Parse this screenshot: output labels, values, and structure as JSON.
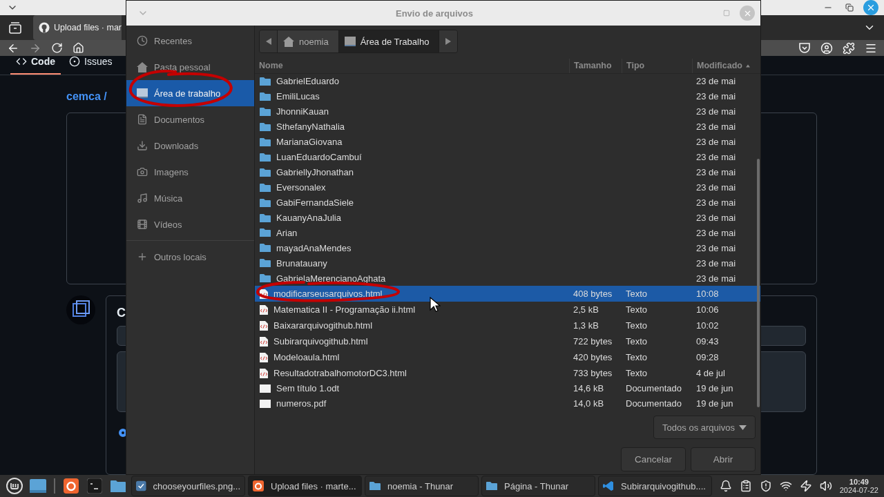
{
  "browser": {
    "tab": {
      "title": "Upload files · mar"
    },
    "repo_tabs": [
      {
        "label": "Code",
        "kind": "code",
        "selected": true
      },
      {
        "label": "Issues",
        "kind": "issues",
        "selected": false
      }
    ],
    "breadcrumb": "cemca /",
    "comment_heading": "C",
    "commit_option": {
      "selected": true
    }
  },
  "dialog": {
    "title": "Envio de arquivos",
    "places": [
      {
        "label": "Recentes",
        "kind": "clock",
        "selected": false
      },
      {
        "label": "Pasta pessoal",
        "kind": "home",
        "selected": false
      },
      {
        "label": "Área de trabalho",
        "kind": "desktop",
        "selected": true
      },
      {
        "label": "Documentos",
        "kind": "document",
        "selected": false
      },
      {
        "label": "Downloads",
        "kind": "download",
        "selected": false
      },
      {
        "label": "Imagens",
        "kind": "camera",
        "selected": false
      },
      {
        "label": "Música",
        "kind": "music",
        "selected": false
      },
      {
        "label": "Vídeos",
        "kind": "film",
        "selected": false
      }
    ],
    "other_places": "Outros locais",
    "path": [
      {
        "label": "noemia",
        "kind": "home",
        "selected": false
      },
      {
        "label": "Área de Trabalho",
        "kind": "desktop",
        "selected": true
      }
    ],
    "columns": [
      {
        "label": "Nome",
        "sorted": false
      },
      {
        "label": "Tamanho",
        "sorted": false
      },
      {
        "label": "Tipo",
        "sorted": false
      },
      {
        "label": "Modificado",
        "sorted": true
      }
    ],
    "files": [
      {
        "name": "GabrielEduardo",
        "kind": "folder",
        "modified": "23 de mai",
        "selected": false
      },
      {
        "name": "EmiliLucas",
        "kind": "folder",
        "modified": "23 de mai",
        "selected": false
      },
      {
        "name": "JhonniKauan",
        "kind": "folder",
        "modified": "23 de mai",
        "selected": false
      },
      {
        "name": "SthefanyNathalia",
        "kind": "folder",
        "modified": "23 de mai",
        "selected": false
      },
      {
        "name": "MarianaGiovana",
        "kind": "folder",
        "modified": "23 de mai",
        "selected": false
      },
      {
        "name": "LuanEduardoCambuí",
        "kind": "folder",
        "modified": "23 de mai",
        "selected": false
      },
      {
        "name": "GabriellyJhonathan",
        "kind": "folder",
        "modified": "23 de mai",
        "selected": false
      },
      {
        "name": "Eversonalex",
        "kind": "folder",
        "modified": "23 de mai",
        "selected": false
      },
      {
        "name": "GabiFernandaSiele",
        "kind": "folder",
        "modified": "23 de mai",
        "selected": false
      },
      {
        "name": "KauanyAnaJulia",
        "kind": "folder",
        "modified": "23 de mai",
        "selected": false
      },
      {
        "name": "Arian",
        "kind": "folder",
        "modified": "23 de mai",
        "selected": false
      },
      {
        "name": "mayadAnaMendes",
        "kind": "folder",
        "modified": "23 de mai",
        "selected": false
      },
      {
        "name": "Brunatauany",
        "kind": "folder",
        "modified": "23 de mai",
        "selected": false
      },
      {
        "name": "GabrielaMerencianoAghata",
        "kind": "folder",
        "modified": "23 de mai",
        "selected": false
      },
      {
        "name": "modificarseusarquivos.html",
        "kind": "html",
        "size": "408 bytes",
        "type": "Texto",
        "modified": "10:08",
        "selected": true
      },
      {
        "name": "Matematica II - Programação ii.html",
        "kind": "html",
        "size": "2,5 kB",
        "type": "Texto",
        "modified": "10:06",
        "selected": false
      },
      {
        "name": "Baixararquivogithub.html",
        "kind": "html",
        "size": "1,3 kB",
        "type": "Texto",
        "modified": "10:02",
        "selected": false
      },
      {
        "name": "Subirarquivogithub.html",
        "kind": "html",
        "size": "722 bytes",
        "type": "Texto",
        "modified": "09:43",
        "selected": false
      },
      {
        "name": "Modeloaula.html",
        "kind": "html",
        "size": "420 bytes",
        "type": "Texto",
        "modified": "09:28",
        "selected": false
      },
      {
        "name": "ResultadotrabalhomotorDC3.html",
        "kind": "html",
        "size": "733 bytes",
        "type": "Texto",
        "modified": "4 de jul",
        "selected": false
      },
      {
        "name": "Sem título 1.odt",
        "kind": "doc",
        "size": "14,6 kB",
        "type": "Documentado",
        "modified": "19 de jun",
        "selected": false
      },
      {
        "name": "numeros.pdf",
        "kind": "doc",
        "size": "14,0 kB",
        "type": "Documentado",
        "modified": "19 de jun",
        "selected": false
      }
    ],
    "filter": "Todos os arquivos",
    "buttons": [
      "Cancelar",
      "Abrir"
    ]
  },
  "taskbar": {
    "windows": [
      {
        "title": "chooseyourfiles.png...",
        "kind": "image",
        "active": false
      },
      {
        "title": "Upload files · marte...",
        "kind": "firefox",
        "active": true
      },
      {
        "title": "noemia - Thunar",
        "kind": "home-folder",
        "active": false
      },
      {
        "title": "Página - Thunar",
        "kind": "folder",
        "active": false
      },
      {
        "title": "Subirarquivogithub....",
        "kind": "vscode",
        "active": false
      }
    ],
    "time": "10:49",
    "date": "2024-07-22"
  }
}
